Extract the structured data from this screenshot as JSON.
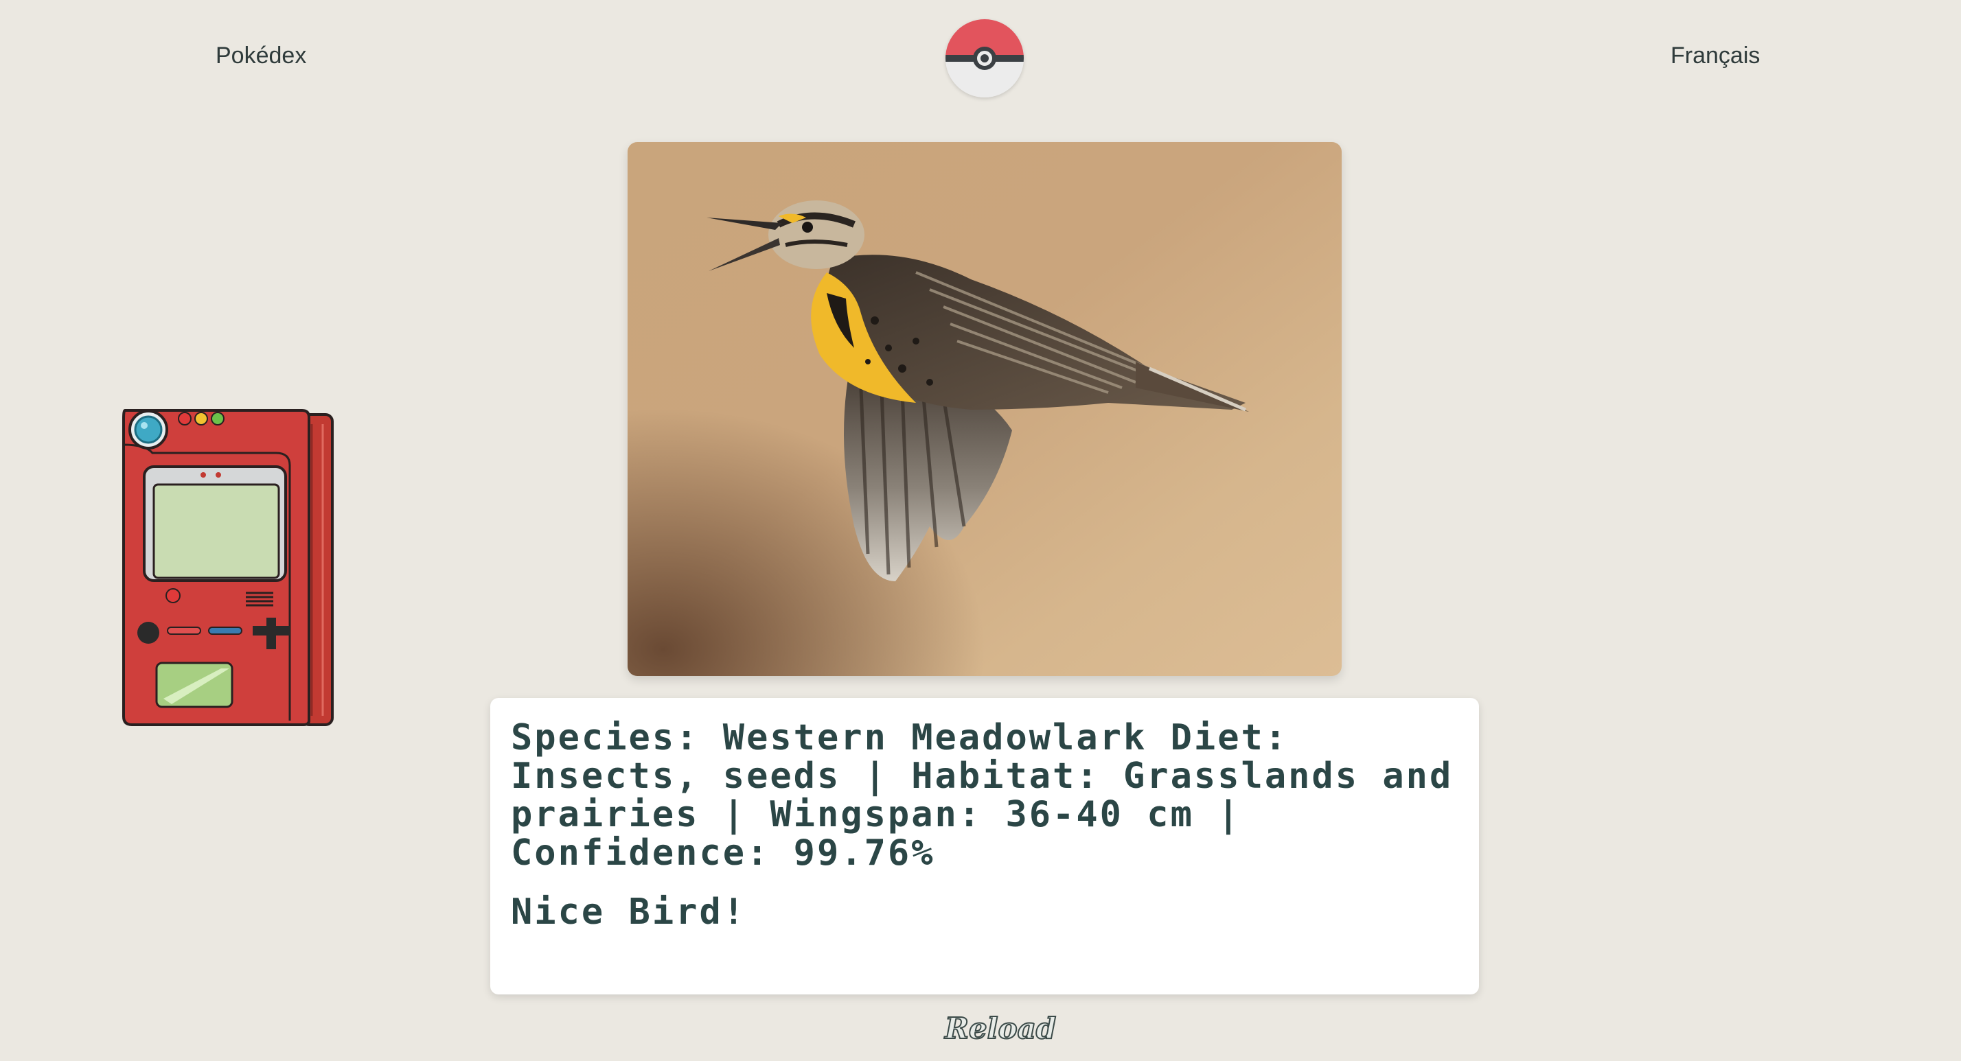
{
  "nav": {
    "left_label": "Pokédex",
    "right_label": "Français"
  },
  "photo": {
    "subject": "western-meadowlark-photo"
  },
  "info": {
    "details": "Species: Western Meadowlark Diet: Insects, seeds | Habitat: Grasslands and prairies | Wingspan: 36-40 cm | Confidence: 99.76%",
    "message": "Nice Bird!"
  },
  "actions": {
    "reload_label": "Reload"
  },
  "colors": {
    "background": "#ebe8e1",
    "pokeball_red": "#e2545d",
    "device_red": "#c9393a",
    "screen_green": "#c9dcb2",
    "text": "#2b4646"
  }
}
